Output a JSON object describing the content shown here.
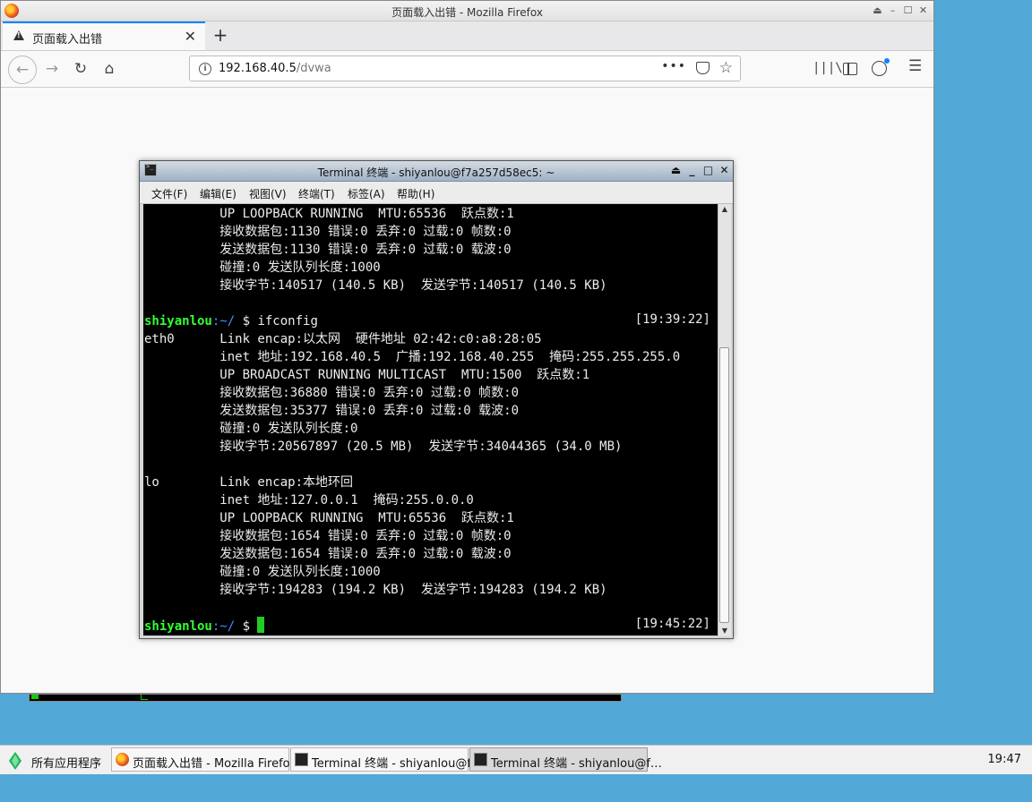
{
  "firefox": {
    "window_title": "页面载入出错 - Mozilla Firefox",
    "tab_title": "页面载入出错",
    "url_host": "192.168.40.5",
    "url_path": "/dvwa"
  },
  "terminal": {
    "window_title": "Terminal 终端 - shiyanlou@f7a257d58ec5: ~",
    "menu": [
      "文件(F)",
      "编辑(E)",
      "视图(V)",
      "终端(T)",
      "标签(A)",
      "帮助(H)"
    ],
    "lines": [
      "          UP LOOPBACK RUNNING  MTU:65536  跃点数:1",
      "          接收数据包:1130 错误:0 丢弃:0 过载:0 帧数:0",
      "          发送数据包:1130 错误:0 丢弃:0 过载:0 载波:0",
      "          碰撞:0 发送队列长度:1000",
      "          接收字节:140517 (140.5 KB)  发送字节:140517 (140.5 KB)",
      "",
      "__PROMPT1__",
      "eth0      Link encap:以太网  硬件地址 02:42:c0:a8:28:05",
      "          inet 地址:192.168.40.5  广播:192.168.40.255  掩码:255.255.255.0",
      "          UP BROADCAST RUNNING MULTICAST  MTU:1500  跃点数:1",
      "          接收数据包:36880 错误:0 丢弃:0 过载:0 帧数:0",
      "          发送数据包:35377 错误:0 丢弃:0 过载:0 载波:0",
      "          碰撞:0 发送队列长度:0",
      "          接收字节:20567897 (20.5 MB)  发送字节:34044365 (34.0 MB)",
      "",
      "lo        Link encap:本地环回",
      "          inet 地址:127.0.0.1  掩码:255.0.0.0",
      "          UP LOOPBACK RUNNING  MTU:65536  跃点数:1",
      "          接收数据包:1654 错误:0 丢弃:0 过载:0 帧数:0",
      "          发送数据包:1654 错误:0 丢弃:0 过载:0 载波:0",
      "          碰撞:0 发送队列长度:1000",
      "          接收字节:194283 (194.2 KB)  发送字节:194283 (194.2 KB)",
      "",
      "__PROMPT2__"
    ],
    "prompt_user": "shiyanlou",
    "prompt_path": ":~/",
    "prompt_sym": " $ ",
    "prompt1_cmd": "ifconfig",
    "prompt1_time": "[19:39:22]",
    "prompt2_time": "[19:45:22]"
  },
  "taskbar": {
    "start_label": "所有应用程序",
    "items": [
      {
        "label": "页面载入出错 - Mozilla Firefox"
      },
      {
        "label": "Terminal 终端 - shiyanlou@f…"
      },
      {
        "label": "Terminal 终端 - shiyanlou@f…"
      }
    ],
    "clock": "19:47"
  }
}
